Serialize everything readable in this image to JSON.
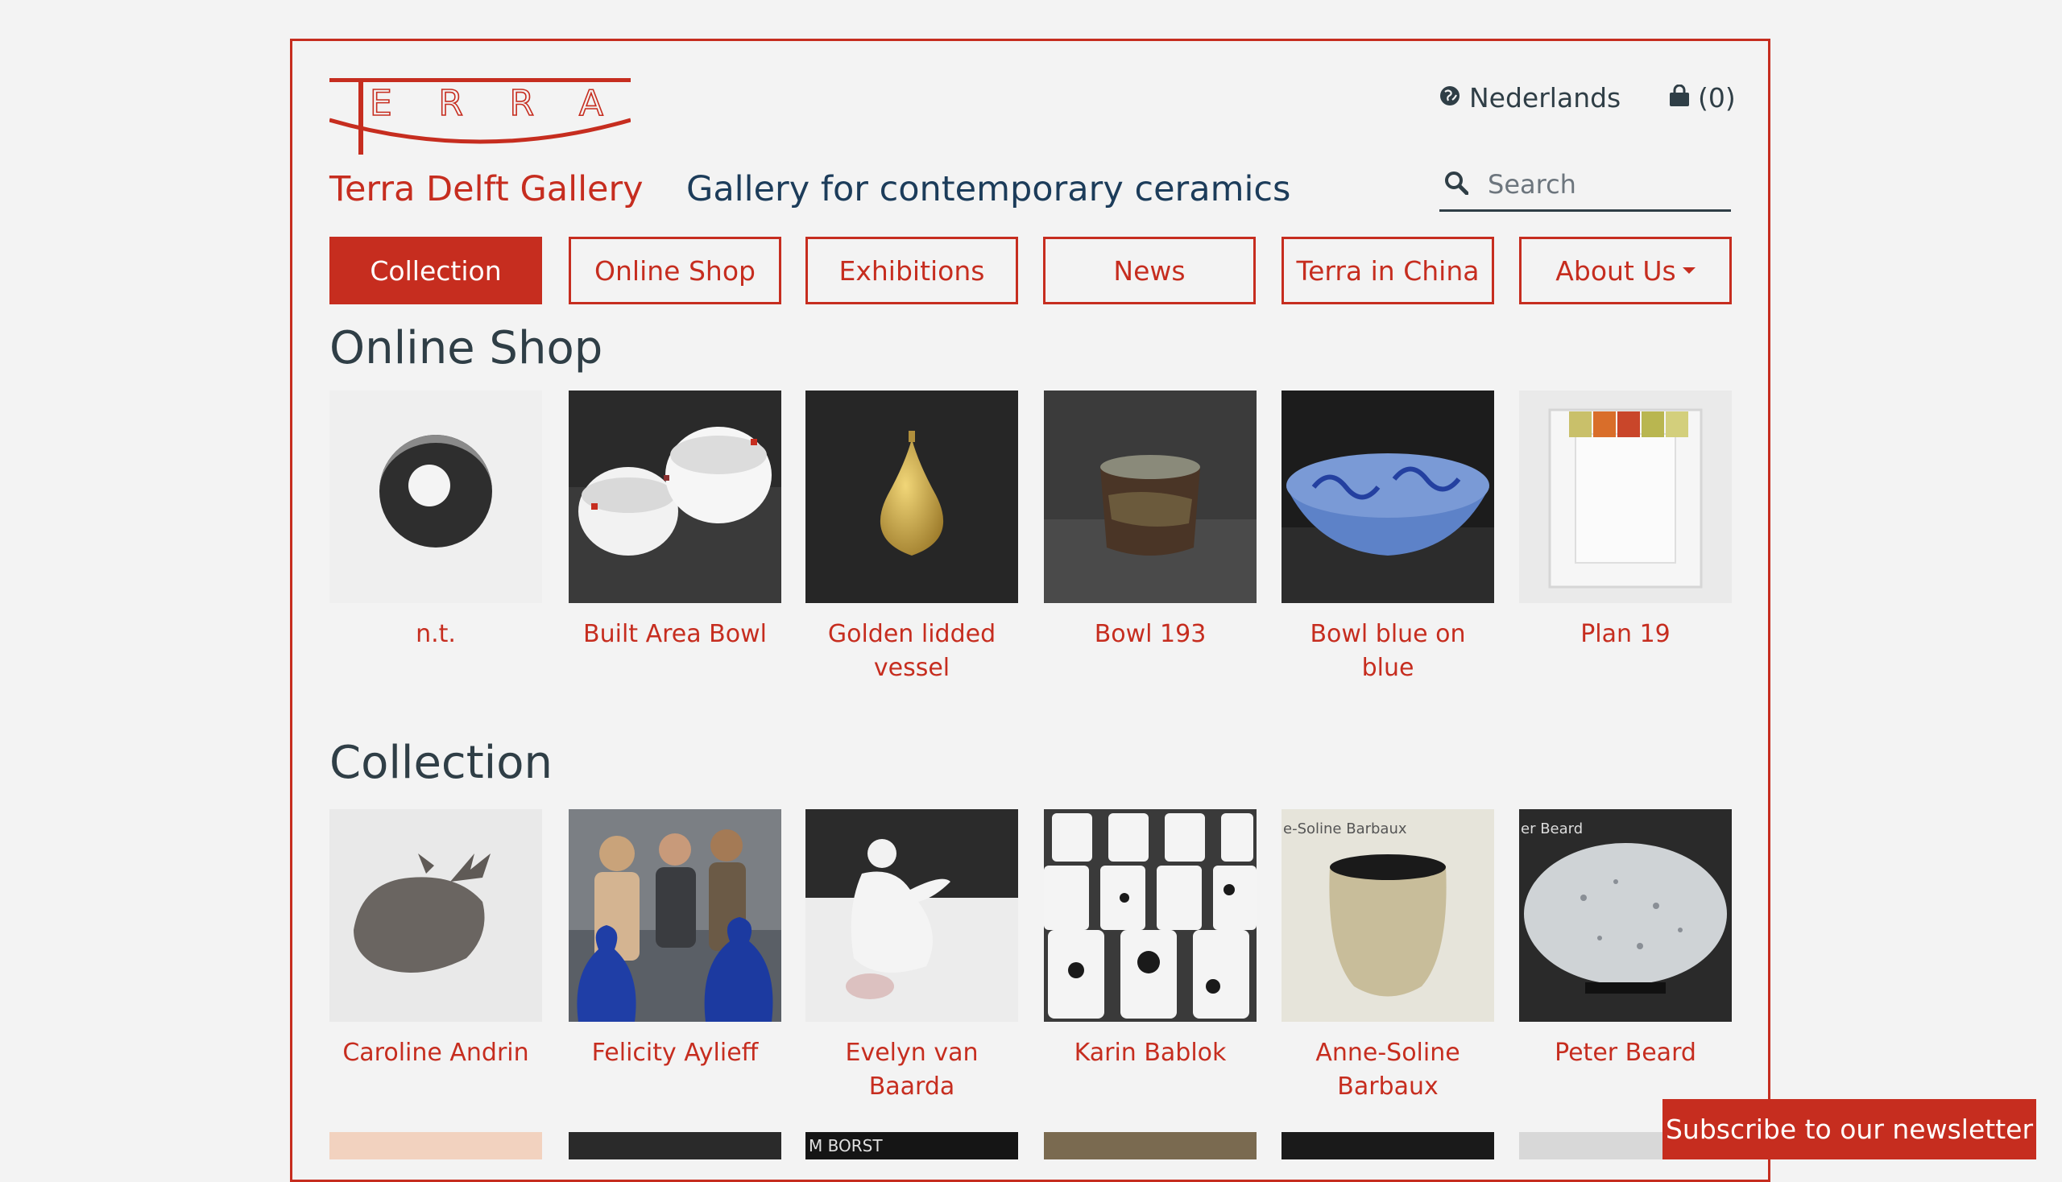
{
  "header": {
    "logo_text": "TERRA",
    "brand_name": "Terra Delft Gallery",
    "tagline": "Gallery for contemporary ceramics",
    "language": "Nederlands",
    "cart": "(0)",
    "search_placeholder": "Search"
  },
  "nav": [
    {
      "label": "Collection",
      "active": true
    },
    {
      "label": "Online Shop"
    },
    {
      "label": "Exhibitions"
    },
    {
      "label": "News"
    },
    {
      "label": "Terra in China"
    },
    {
      "label": "About Us"
    }
  ],
  "online_shop": {
    "title": "Online Shop",
    "items": [
      {
        "label": "n.t."
      },
      {
        "label": "Built Area Bowl"
      },
      {
        "label": "Golden lidded vessel"
      },
      {
        "label": "Bowl 193"
      },
      {
        "label": "Bowl blue on blue"
      },
      {
        "label": "Plan 19"
      }
    ]
  },
  "collection": {
    "title": "Collection",
    "items": [
      {
        "label": "Caroline Andrin"
      },
      {
        "label": "Felicity Aylieff"
      },
      {
        "label": "Evelyn van Baarda"
      },
      {
        "label": "Karin Bablok"
      },
      {
        "label": "Anne-Soline Barbaux",
        "photo_caption": "e-Soline Barbaux"
      },
      {
        "label": "Peter Beard",
        "photo_caption": "er Beard"
      }
    ],
    "partial_caption": "M BORST"
  },
  "newsletter": "Subscribe to our newsletter",
  "colors": {
    "accent": "#c62d1f",
    "text": "#2f3e46",
    "tagline": "#1c3c5a",
    "background": "#f3f3f3"
  }
}
